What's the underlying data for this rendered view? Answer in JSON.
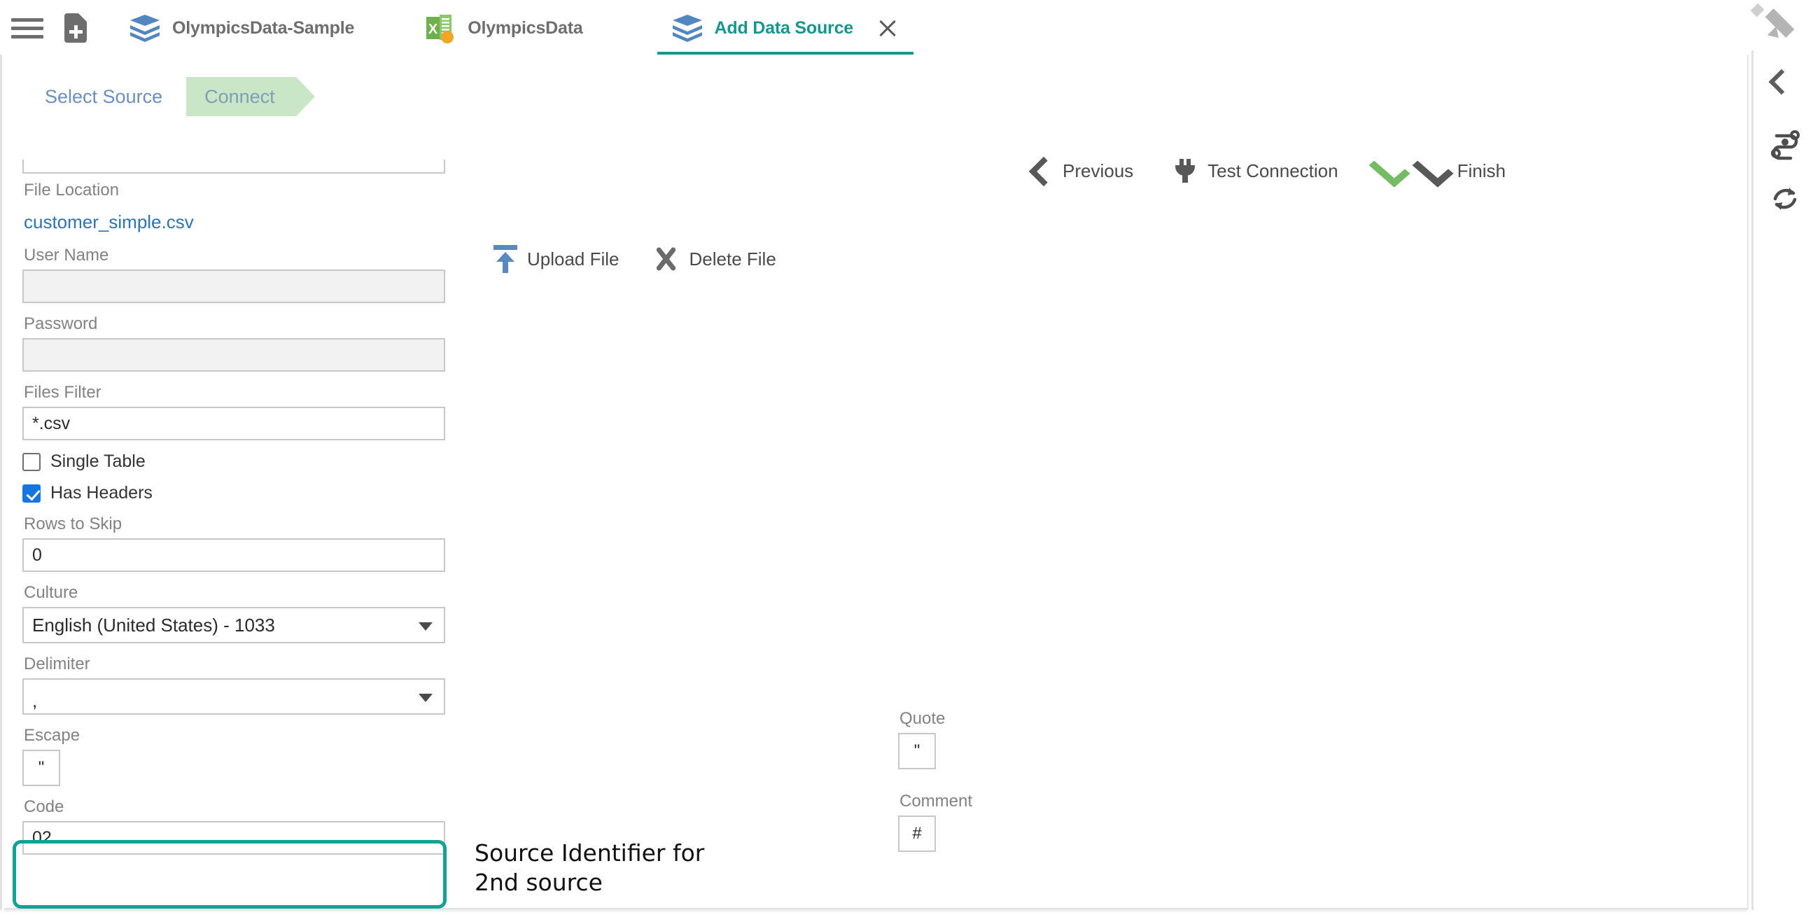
{
  "tabs": [
    {
      "label": "OlympicsData-Sample",
      "icon": "layers-icon",
      "active": false
    },
    {
      "label": "OlympicsData",
      "icon": "excel-icon",
      "active": false
    },
    {
      "label": "Add Data Source",
      "icon": "layers-icon",
      "active": true
    }
  ],
  "toolbar": {
    "menu_icon": "hamburger-icon",
    "new_file_icon": "new-file-icon",
    "close_icon": "close-icon"
  },
  "steps": [
    {
      "label": "Select Source",
      "state": "inactive"
    },
    {
      "label": "Connect",
      "state": "current"
    }
  ],
  "actions": [
    {
      "label": "Previous",
      "icon": "chevron-left-icon"
    },
    {
      "label": "Test Connection",
      "icon": "plug-icon"
    },
    {
      "label": "",
      "icon": "check-green-icon"
    },
    {
      "label": "Finish",
      "icon": "check-dark-icon"
    }
  ],
  "file_actions": [
    {
      "label": "Upload File",
      "icon": "upload-icon"
    },
    {
      "label": "Delete File",
      "icon": "delete-x-icon"
    }
  ],
  "form": {
    "scrolled_field": {
      "value": ""
    },
    "file_location": {
      "label": "File Location",
      "value": "customer_simple.csv"
    },
    "user_name": {
      "label": "User Name",
      "value": ""
    },
    "password": {
      "label": "Password",
      "value": ""
    },
    "files_filter": {
      "label": "Files Filter",
      "value": "*.csv"
    },
    "single_table": {
      "label": "Single Table",
      "checked": false
    },
    "has_headers": {
      "label": "Has Headers",
      "checked": true
    },
    "rows_to_skip": {
      "label": "Rows to Skip",
      "value": "0"
    },
    "culture": {
      "label": "Culture",
      "value": "English (United States) - 1033"
    },
    "delimiter": {
      "label": "Delimiter",
      "value": ","
    },
    "escape": {
      "label": "Escape",
      "value": "\""
    },
    "code": {
      "label": "Code",
      "value": "02"
    },
    "quote": {
      "label": "Quote",
      "value": "\""
    },
    "comment": {
      "label": "Comment",
      "value": "#"
    }
  },
  "annotation": {
    "line1": "Source Identifier for",
    "line2": "2nd source",
    "color": "#11a294"
  },
  "rail": [
    {
      "icon": "pencil-icon"
    },
    {
      "icon": "chevron-left-icon"
    },
    {
      "icon": "pipeline-icon"
    },
    {
      "icon": "sync-icon"
    }
  ],
  "colors": {
    "accent_teal": "#16968c",
    "step_green": "#c9e6c6",
    "link_blue": "#2e74b5",
    "checkbox_blue": "#1675e0",
    "success_green": "#74bb63"
  }
}
